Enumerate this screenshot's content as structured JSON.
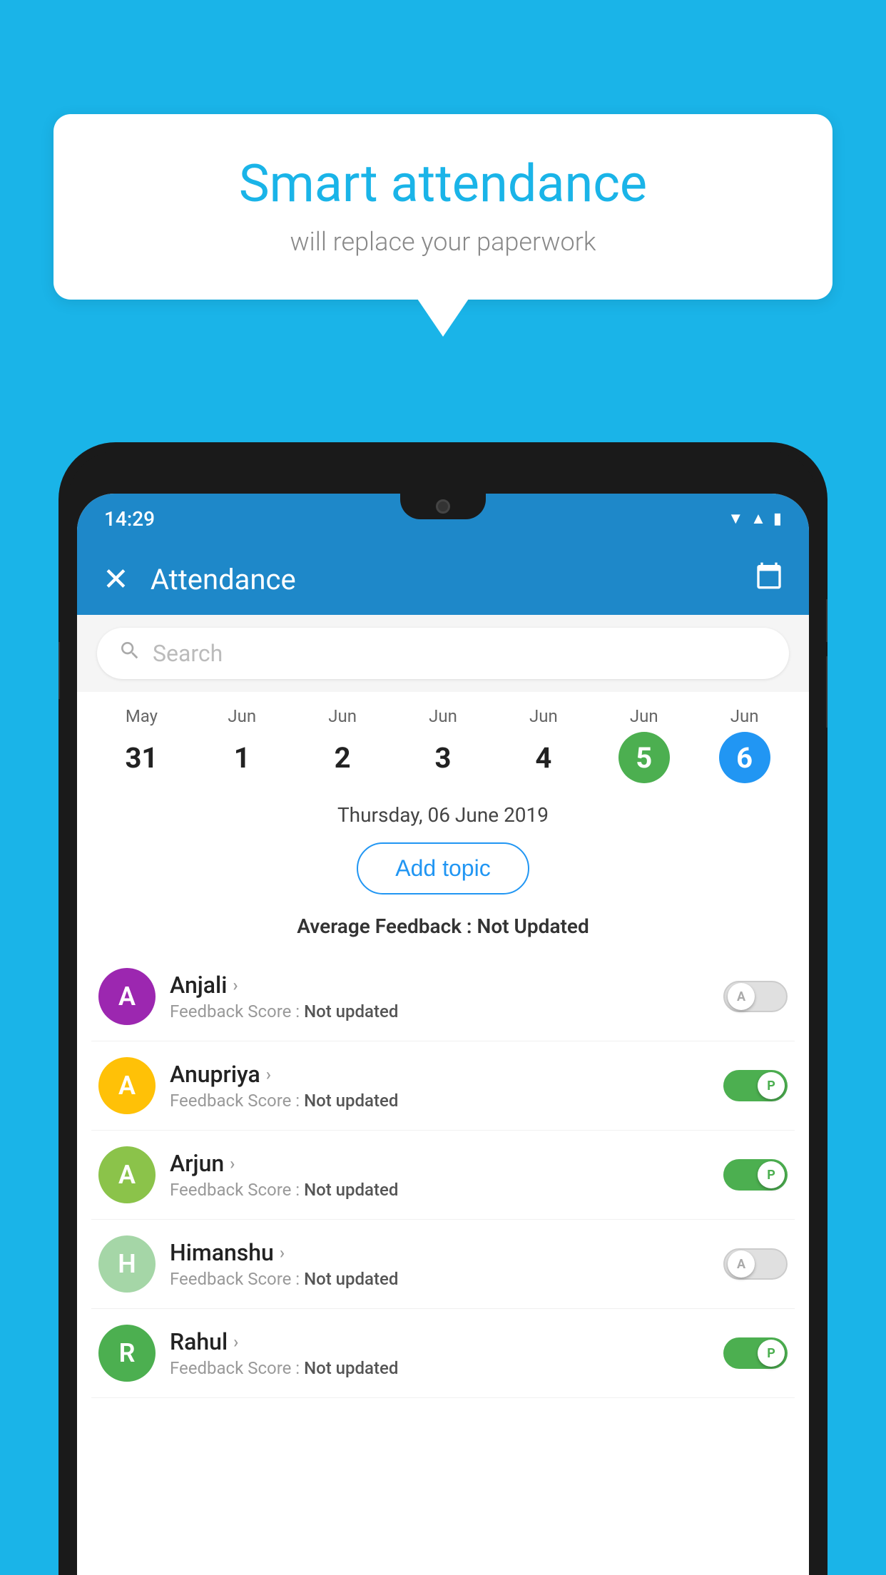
{
  "background_color": "#1ab4e8",
  "bubble": {
    "title": "Smart attendance",
    "subtitle": "will replace your paperwork"
  },
  "app": {
    "status_time": "14:29",
    "header_title": "Attendance",
    "close_label": "✕",
    "search_placeholder": "Search",
    "date_label": "Thursday, 06 June 2019",
    "add_topic_label": "Add topic",
    "avg_feedback_label": "Average Feedback :",
    "avg_feedback_value": "Not Updated"
  },
  "calendar": {
    "days": [
      {
        "month": "May",
        "date": "31",
        "state": "normal"
      },
      {
        "month": "Jun",
        "date": "1",
        "state": "normal"
      },
      {
        "month": "Jun",
        "date": "2",
        "state": "normal"
      },
      {
        "month": "Jun",
        "date": "3",
        "state": "normal"
      },
      {
        "month": "Jun",
        "date": "4",
        "state": "normal"
      },
      {
        "month": "Jun",
        "date": "5",
        "state": "today"
      },
      {
        "month": "Jun",
        "date": "6",
        "state": "selected"
      }
    ]
  },
  "students": [
    {
      "name": "Anjali",
      "initial": "A",
      "avatar_color": "#9c27b0",
      "feedback": "Not updated",
      "toggle_state": "off",
      "toggle_label": "A"
    },
    {
      "name": "Anupriya",
      "initial": "A",
      "avatar_color": "#ffc107",
      "feedback": "Not updated",
      "toggle_state": "on",
      "toggle_label": "P"
    },
    {
      "name": "Arjun",
      "initial": "A",
      "avatar_color": "#8bc34a",
      "feedback": "Not updated",
      "toggle_state": "on",
      "toggle_label": "P"
    },
    {
      "name": "Himanshu",
      "initial": "H",
      "avatar_color": "#a5d6a7",
      "feedback": "Not updated",
      "toggle_state": "off",
      "toggle_label": "A"
    },
    {
      "name": "Rahul",
      "initial": "R",
      "avatar_color": "#4caf50",
      "feedback": "Not updated",
      "toggle_state": "on",
      "toggle_label": "P"
    }
  ],
  "icons": {
    "close": "✕",
    "calendar": "📅",
    "search": "🔍",
    "chevron": "›"
  }
}
